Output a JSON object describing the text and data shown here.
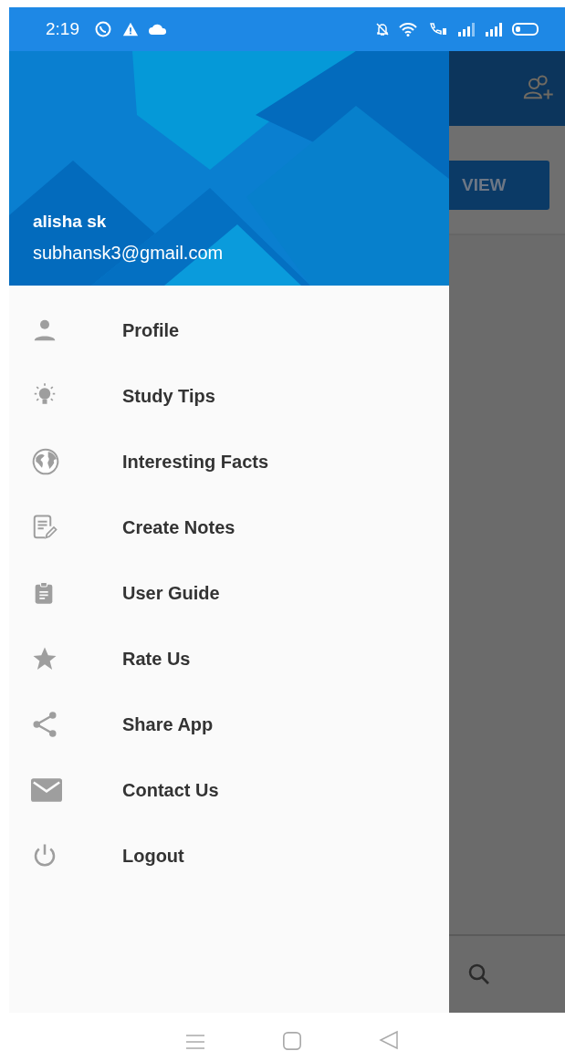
{
  "status_bar": {
    "time": "2:19"
  },
  "drawer": {
    "header": {
      "name": "alisha sk",
      "email": "subhansk3@gmail.com"
    },
    "items": [
      {
        "label": "Profile"
      },
      {
        "label": "Study Tips"
      },
      {
        "label": "Interesting Facts"
      },
      {
        "label": "Create Notes"
      },
      {
        "label": "User Guide"
      },
      {
        "label": "Rate Us"
      },
      {
        "label": "Share App"
      },
      {
        "label": "Contact Us"
      },
      {
        "label": "Logout"
      }
    ]
  },
  "background": {
    "button": "VIEW"
  }
}
